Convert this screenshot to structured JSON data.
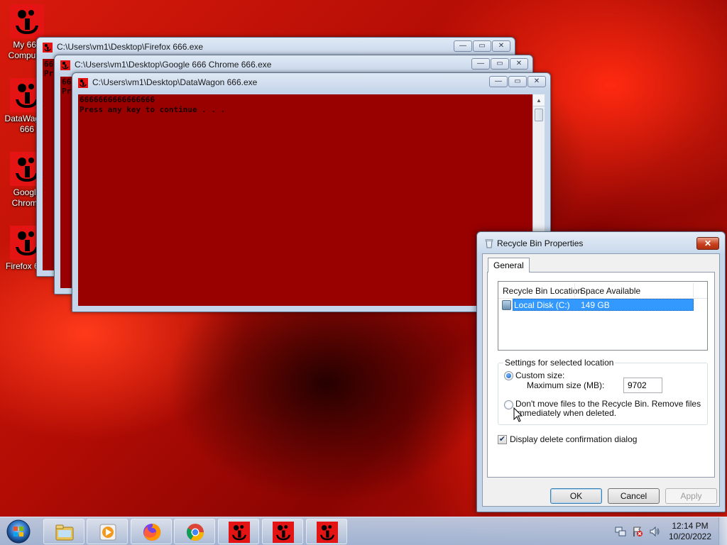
{
  "desktop": {
    "icons": [
      {
        "label": "My 666 Computer"
      },
      {
        "label": "DataWagon 666"
      },
      {
        "label": "Google Chrome"
      },
      {
        "label": "Firefox 666"
      }
    ]
  },
  "windows": {
    "firefox": {
      "title": "C:\\Users\\vm1\\Desktop\\Firefox 666.exe",
      "text": "66\nPr"
    },
    "chrome": {
      "title": "C:\\Users\\vm1\\Desktop\\Google 666 Chrome 666.exe",
      "text": "66\nPr"
    },
    "datawagon": {
      "title": "C:\\Users\\vm1\\Desktop\\DataWagon 666.exe",
      "line1": "6666666666666666",
      "line2": "Press any key to continue . . ."
    }
  },
  "dialog": {
    "title": "Recycle Bin Properties",
    "tab": "General",
    "columns": [
      "Recycle Bin Location",
      "Space Available"
    ],
    "rows": [
      {
        "location": "Local Disk (C:)",
        "space": "149 GB",
        "selected": true
      }
    ],
    "settings_group": "Settings for selected location",
    "custom_size_label": "Custom size:",
    "max_size_label": "Maximum size (MB):",
    "max_size_value": "9702",
    "dont_move_label_1": "Don't move files to the Recycle Bin. Remove files",
    "dont_move_label_2": "immediately when deleted.",
    "custom_size_selected": true,
    "display_confirm_label": "Display delete confirmation dialog",
    "display_confirm_checked": true,
    "ok": "OK",
    "cancel": "Cancel",
    "apply": "Apply"
  },
  "taskbar": {
    "time": "12:14 PM",
    "date": "10/20/2022"
  },
  "colors": {
    "console_bg": "#990000",
    "selection": "#3399ff",
    "icon_red": "#e41414"
  }
}
